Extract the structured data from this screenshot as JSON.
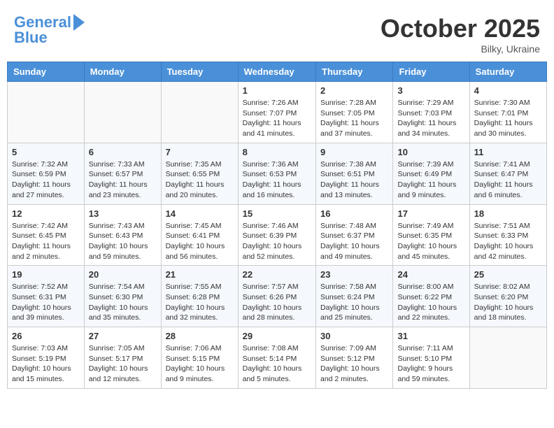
{
  "header": {
    "logo_line1": "General",
    "logo_line2": "Blue",
    "month": "October 2025",
    "location": "Bilky, Ukraine"
  },
  "days_of_week": [
    "Sunday",
    "Monday",
    "Tuesday",
    "Wednesday",
    "Thursday",
    "Friday",
    "Saturday"
  ],
  "weeks": [
    [
      {
        "day": "",
        "info": ""
      },
      {
        "day": "",
        "info": ""
      },
      {
        "day": "",
        "info": ""
      },
      {
        "day": "1",
        "info": "Sunrise: 7:26 AM\nSunset: 7:07 PM\nDaylight: 11 hours\nand 41 minutes."
      },
      {
        "day": "2",
        "info": "Sunrise: 7:28 AM\nSunset: 7:05 PM\nDaylight: 11 hours\nand 37 minutes."
      },
      {
        "day": "3",
        "info": "Sunrise: 7:29 AM\nSunset: 7:03 PM\nDaylight: 11 hours\nand 34 minutes."
      },
      {
        "day": "4",
        "info": "Sunrise: 7:30 AM\nSunset: 7:01 PM\nDaylight: 11 hours\nand 30 minutes."
      }
    ],
    [
      {
        "day": "5",
        "info": "Sunrise: 7:32 AM\nSunset: 6:59 PM\nDaylight: 11 hours\nand 27 minutes."
      },
      {
        "day": "6",
        "info": "Sunrise: 7:33 AM\nSunset: 6:57 PM\nDaylight: 11 hours\nand 23 minutes."
      },
      {
        "day": "7",
        "info": "Sunrise: 7:35 AM\nSunset: 6:55 PM\nDaylight: 11 hours\nand 20 minutes."
      },
      {
        "day": "8",
        "info": "Sunrise: 7:36 AM\nSunset: 6:53 PM\nDaylight: 11 hours\nand 16 minutes."
      },
      {
        "day": "9",
        "info": "Sunrise: 7:38 AM\nSunset: 6:51 PM\nDaylight: 11 hours\nand 13 minutes."
      },
      {
        "day": "10",
        "info": "Sunrise: 7:39 AM\nSunset: 6:49 PM\nDaylight: 11 hours\nand 9 minutes."
      },
      {
        "day": "11",
        "info": "Sunrise: 7:41 AM\nSunset: 6:47 PM\nDaylight: 11 hours\nand 6 minutes."
      }
    ],
    [
      {
        "day": "12",
        "info": "Sunrise: 7:42 AM\nSunset: 6:45 PM\nDaylight: 11 hours\nand 2 minutes."
      },
      {
        "day": "13",
        "info": "Sunrise: 7:43 AM\nSunset: 6:43 PM\nDaylight: 10 hours\nand 59 minutes."
      },
      {
        "day": "14",
        "info": "Sunrise: 7:45 AM\nSunset: 6:41 PM\nDaylight: 10 hours\nand 56 minutes."
      },
      {
        "day": "15",
        "info": "Sunrise: 7:46 AM\nSunset: 6:39 PM\nDaylight: 10 hours\nand 52 minutes."
      },
      {
        "day": "16",
        "info": "Sunrise: 7:48 AM\nSunset: 6:37 PM\nDaylight: 10 hours\nand 49 minutes."
      },
      {
        "day": "17",
        "info": "Sunrise: 7:49 AM\nSunset: 6:35 PM\nDaylight: 10 hours\nand 45 minutes."
      },
      {
        "day": "18",
        "info": "Sunrise: 7:51 AM\nSunset: 6:33 PM\nDaylight: 10 hours\nand 42 minutes."
      }
    ],
    [
      {
        "day": "19",
        "info": "Sunrise: 7:52 AM\nSunset: 6:31 PM\nDaylight: 10 hours\nand 39 minutes."
      },
      {
        "day": "20",
        "info": "Sunrise: 7:54 AM\nSunset: 6:30 PM\nDaylight: 10 hours\nand 35 minutes."
      },
      {
        "day": "21",
        "info": "Sunrise: 7:55 AM\nSunset: 6:28 PM\nDaylight: 10 hours\nand 32 minutes."
      },
      {
        "day": "22",
        "info": "Sunrise: 7:57 AM\nSunset: 6:26 PM\nDaylight: 10 hours\nand 28 minutes."
      },
      {
        "day": "23",
        "info": "Sunrise: 7:58 AM\nSunset: 6:24 PM\nDaylight: 10 hours\nand 25 minutes."
      },
      {
        "day": "24",
        "info": "Sunrise: 8:00 AM\nSunset: 6:22 PM\nDaylight: 10 hours\nand 22 minutes."
      },
      {
        "day": "25",
        "info": "Sunrise: 8:02 AM\nSunset: 6:20 PM\nDaylight: 10 hours\nand 18 minutes."
      }
    ],
    [
      {
        "day": "26",
        "info": "Sunrise: 7:03 AM\nSunset: 5:19 PM\nDaylight: 10 hours\nand 15 minutes."
      },
      {
        "day": "27",
        "info": "Sunrise: 7:05 AM\nSunset: 5:17 PM\nDaylight: 10 hours\nand 12 minutes."
      },
      {
        "day": "28",
        "info": "Sunrise: 7:06 AM\nSunset: 5:15 PM\nDaylight: 10 hours\nand 9 minutes."
      },
      {
        "day": "29",
        "info": "Sunrise: 7:08 AM\nSunset: 5:14 PM\nDaylight: 10 hours\nand 5 minutes."
      },
      {
        "day": "30",
        "info": "Sunrise: 7:09 AM\nSunset: 5:12 PM\nDaylight: 10 hours\nand 2 minutes."
      },
      {
        "day": "31",
        "info": "Sunrise: 7:11 AM\nSunset: 5:10 PM\nDaylight: 9 hours\nand 59 minutes."
      },
      {
        "day": "",
        "info": ""
      }
    ]
  ]
}
